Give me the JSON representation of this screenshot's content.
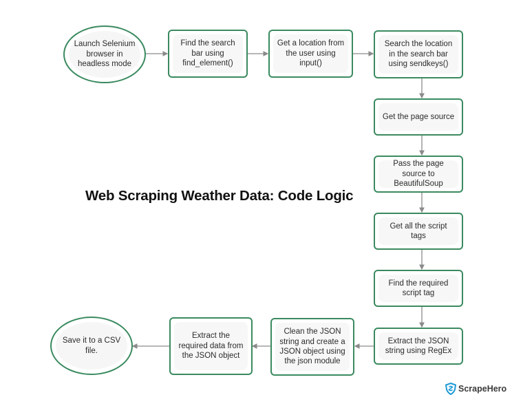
{
  "title": "Web Scraping Weather Data: Code Logic",
  "steps": [
    {
      "id": "launch",
      "label": "Launch Selenium browser in headless mode",
      "shape": "terminal"
    },
    {
      "id": "find-search-bar",
      "label": "Find the search bar using find_element()",
      "shape": "process"
    },
    {
      "id": "get-location",
      "label": "Get a location from the user using input()",
      "shape": "process"
    },
    {
      "id": "search-location",
      "label": "Search the location in the search bar using sendkeys()",
      "shape": "process"
    },
    {
      "id": "get-page-source",
      "label": "Get the page source",
      "shape": "process"
    },
    {
      "id": "pass-to-bs",
      "label": "Pass the page source to BeautifulSoup",
      "shape": "process"
    },
    {
      "id": "get-script-tags",
      "label": "Get all the script tags",
      "shape": "process"
    },
    {
      "id": "find-script-tag",
      "label": "Find the required script tag",
      "shape": "process"
    },
    {
      "id": "extract-json",
      "label": "Extract the JSON string using RegEx",
      "shape": "process"
    },
    {
      "id": "clean-json",
      "label": "Clean the JSON string and create a JSON object using the json module",
      "shape": "process"
    },
    {
      "id": "extract-data",
      "label": "Extract the required data from the JSON object",
      "shape": "process"
    },
    {
      "id": "save-csv",
      "label": "Save it to a CSV file.",
      "shape": "terminal"
    }
  ],
  "edges": [
    [
      "launch",
      "find-search-bar"
    ],
    [
      "find-search-bar",
      "get-location"
    ],
    [
      "get-location",
      "search-location"
    ],
    [
      "search-location",
      "get-page-source"
    ],
    [
      "get-page-source",
      "pass-to-bs"
    ],
    [
      "pass-to-bs",
      "get-script-tags"
    ],
    [
      "get-script-tags",
      "find-script-tag"
    ],
    [
      "find-script-tag",
      "extract-json"
    ],
    [
      "extract-json",
      "clean-json"
    ],
    [
      "clean-json",
      "extract-data"
    ],
    [
      "extract-data",
      "save-csv"
    ]
  ],
  "logo": {
    "text": "ScrapeHero",
    "icon": "shield-icon",
    "color": "#1e9ad6"
  },
  "colors": {
    "node_border": "#3a8a5f",
    "node_fill": "#f7f7f7",
    "arrow": "#8a8a8a"
  }
}
